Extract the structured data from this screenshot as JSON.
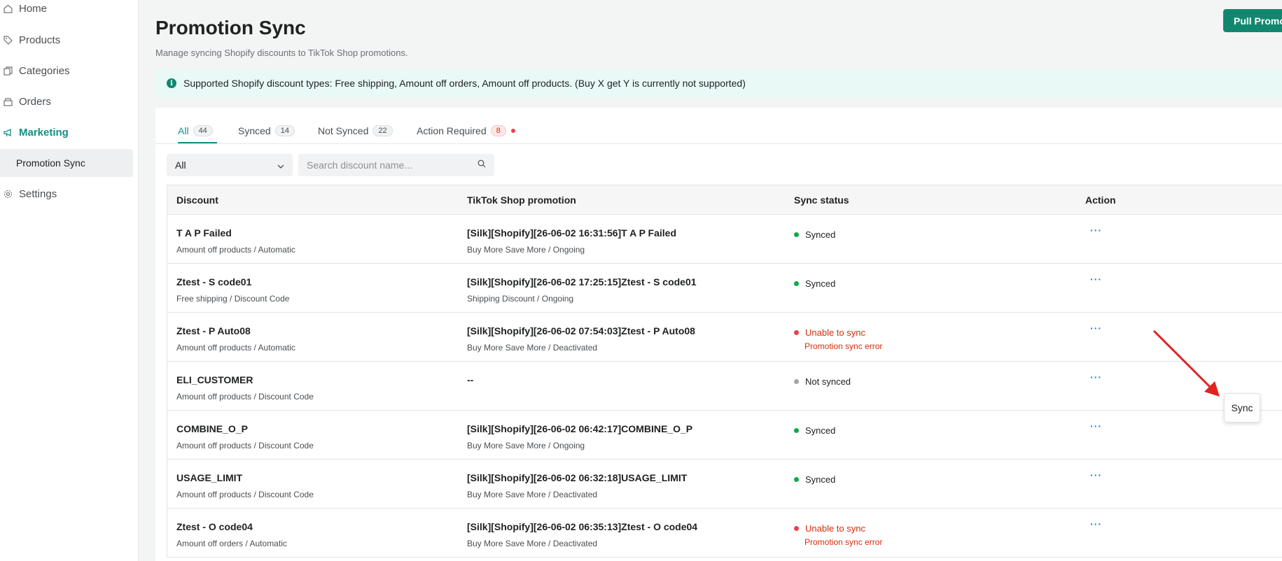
{
  "sidebar": {
    "items": [
      {
        "label": "Home",
        "icon": "home-icon"
      },
      {
        "label": "Products",
        "icon": "tag-icon"
      },
      {
        "label": "Categories",
        "icon": "categories-icon"
      },
      {
        "label": "Orders",
        "icon": "orders-icon"
      },
      {
        "label": "Marketing",
        "icon": "megaphone-icon",
        "active": true
      },
      {
        "label": "Promotion Sync",
        "sub": true,
        "selected": true
      },
      {
        "label": "Settings",
        "icon": "gear-icon"
      }
    ]
  },
  "header": {
    "title": "Promotion Sync",
    "subtitle": "Manage syncing Shopify discounts to TikTok Shop promotions.",
    "pull_button": "Pull Promo"
  },
  "banner": {
    "text": "Supported Shopify discount types: Free shipping, Amount off orders, Amount off products. (Buy X get Y is currently not supported)"
  },
  "tabs": [
    {
      "label": "All",
      "count": "44",
      "active": true
    },
    {
      "label": "Synced",
      "count": "14"
    },
    {
      "label": "Not Synced",
      "count": "22"
    },
    {
      "label": "Action Required",
      "count": "8",
      "alert": true
    }
  ],
  "filter": {
    "selected": "All",
    "search_placeholder": "Search discount name..."
  },
  "table": {
    "columns": [
      "Discount",
      "TikTok Shop promotion",
      "Sync status",
      "Action"
    ],
    "rows": [
      {
        "name": "T A P Failed",
        "type": "Amount off products / Automatic",
        "promo": "[Silk][Shopify][26-06-02 16:31:56]T A P Failed",
        "promo_sub": "Buy More Save More / Ongoing",
        "status": "Synced",
        "status_kind": "ok",
        "status_sub": "",
        "action": "···"
      },
      {
        "name": "Ztest - S code01",
        "type": "Free shipping / Discount Code",
        "promo": "[Silk][Shopify][26-06-02 17:25:15]Ztest - S code01",
        "promo_sub": "Shipping Discount / Ongoing",
        "status": "Synced",
        "status_kind": "ok",
        "status_sub": "",
        "action": "···"
      },
      {
        "name": "Ztest - P Auto08",
        "type": "Amount off products / Automatic",
        "promo": "[Silk][Shopify][26-06-02 07:54:03]Ztest - P Auto08",
        "promo_sub": "Buy More Save More / Deactivated",
        "status": "Unable to sync",
        "status_kind": "err",
        "status_sub": "Promotion sync error",
        "action": "···"
      },
      {
        "name": "ELI_CUSTOMER",
        "type": "Amount off products / Discount Code",
        "promo": "--",
        "promo_sub": "",
        "status": "Not synced",
        "status_kind": "none",
        "status_sub": "",
        "action": "···"
      },
      {
        "name": "COMBINE_O_P",
        "type": "Amount off products / Discount Code",
        "promo": "[Silk][Shopify][26-06-02 06:42:17]COMBINE_O_P",
        "promo_sub": "Buy More Save More / Ongoing",
        "status": "Synced",
        "status_kind": "ok",
        "status_sub": "",
        "action": "···"
      },
      {
        "name": "USAGE_LIMIT",
        "type": "Amount off products / Discount Code",
        "promo": "[Silk][Shopify][26-06-02 06:32:18]USAGE_LIMIT",
        "promo_sub": "Buy More Save More / Deactivated",
        "status": "Synced",
        "status_kind": "ok",
        "status_sub": "",
        "action": "···"
      },
      {
        "name": "Ztest - O code04",
        "type": "Amount off orders / Automatic",
        "promo": "[Silk][Shopify][26-06-02 06:35:13]Ztest - O code04",
        "promo_sub": "Buy More Save More / Deactivated",
        "status": "Unable to sync",
        "status_kind": "err",
        "status_sub": "Promotion sync error",
        "action": "···"
      }
    ]
  },
  "popover": {
    "label": "Sync"
  },
  "colors": {
    "accent": "#158f83",
    "button": "#12876f",
    "error": "#d72c0d",
    "success": "#12a84a",
    "arrow": "#e02424"
  }
}
